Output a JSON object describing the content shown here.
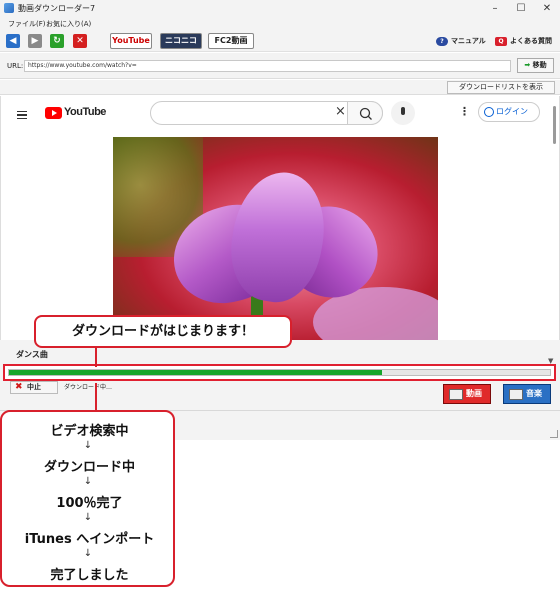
{
  "window": {
    "title": "動画ダウンローダー7",
    "minimize": "–",
    "maximize": "☐",
    "close": "✕"
  },
  "menu": {
    "items": [
      "ファイル(F)",
      "お気に入り(A)"
    ]
  },
  "toolbar": {
    "sites": [
      "YouTube",
      "ニコニコ",
      "FC2動画"
    ],
    "help_manual": "マニュアル",
    "help_faq": "よくある質問"
  },
  "urlbar": {
    "label": "URL:",
    "value": "https://www.youtube.com/watch?v=",
    "go_label": "移動"
  },
  "download_list_button": "ダウンロードリストを表示",
  "youtube": {
    "logo_text": "YouTube",
    "login_label": "ログイン"
  },
  "download": {
    "title": "ダンス曲",
    "progress": 0.69,
    "stop_label": "中止",
    "status": "ダウンロード中…",
    "video_label": "動画",
    "audio_label": "音楽"
  },
  "callout": {
    "text": "ダウンロードがはじまります！"
  },
  "steps": [
    "ビデオ検索中",
    "ダウンロード中",
    "100％完了",
    "iTunes へインポート",
    "完了しました"
  ],
  "colors": {
    "accent_red": "#d8202c",
    "progress_green": "#16a62a",
    "youtube_red": "#ff0000"
  }
}
